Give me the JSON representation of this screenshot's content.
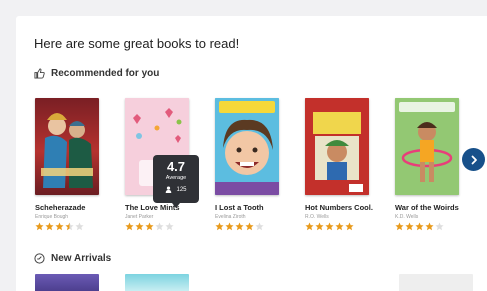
{
  "page": {
    "heading": "Here are some great books to read!"
  },
  "recommended": {
    "label": "Recommended for you",
    "books": [
      {
        "title": "Scheherazade",
        "author": "Enrique Bough",
        "rating": 3.5
      },
      {
        "title": "The Love Mints",
        "author": "Janet Parker",
        "rating": 3
      },
      {
        "title": "I Lost a Tooth",
        "author": "Evelina Ziroth",
        "rating": 4
      },
      {
        "title": "Hot Numbers Cool...",
        "author": "R.O. Wells",
        "rating": 5
      },
      {
        "title": "War of the Woirds",
        "author": "K.D. Wells",
        "rating": 4
      }
    ],
    "tooltip": {
      "average": "4.7",
      "average_label": "Average",
      "votes": "125"
    }
  },
  "new_arrivals": {
    "label": "New Arrivals"
  },
  "colors": {
    "accent": "#17508a",
    "star": "#e89a1c",
    "star_empty": "#dedede"
  }
}
